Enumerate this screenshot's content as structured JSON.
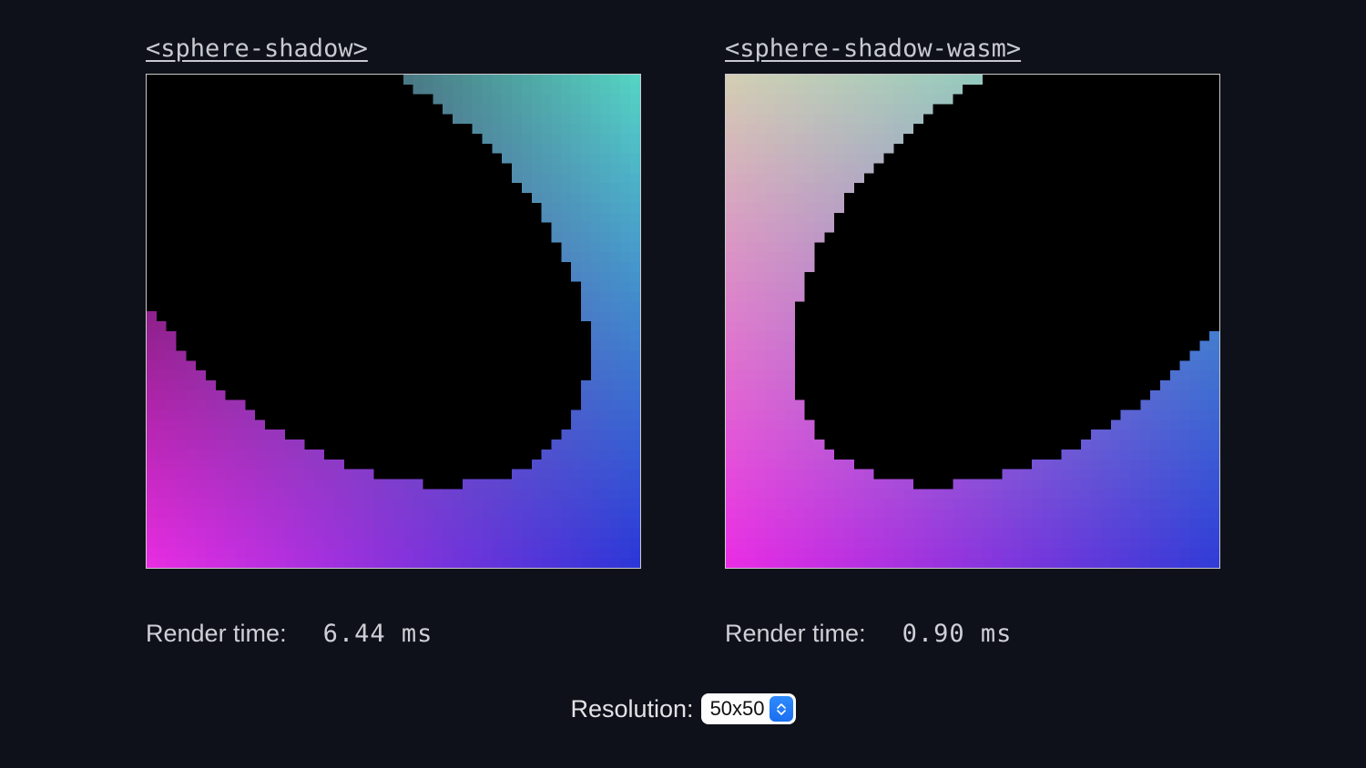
{
  "panels": [
    {
      "title": "<sphere-shadow>",
      "render_label": "Render time:",
      "render_value": "6.44 ms",
      "grid_size": 50,
      "variant": 0
    },
    {
      "title": "<sphere-shadow-wasm>",
      "render_label": "Render time:",
      "render_value": "0.90 ms",
      "grid_size": 50,
      "variant": 1
    }
  ],
  "resolution": {
    "label": "Resolution:",
    "selected": "50x50",
    "options": [
      "50x50"
    ]
  }
}
